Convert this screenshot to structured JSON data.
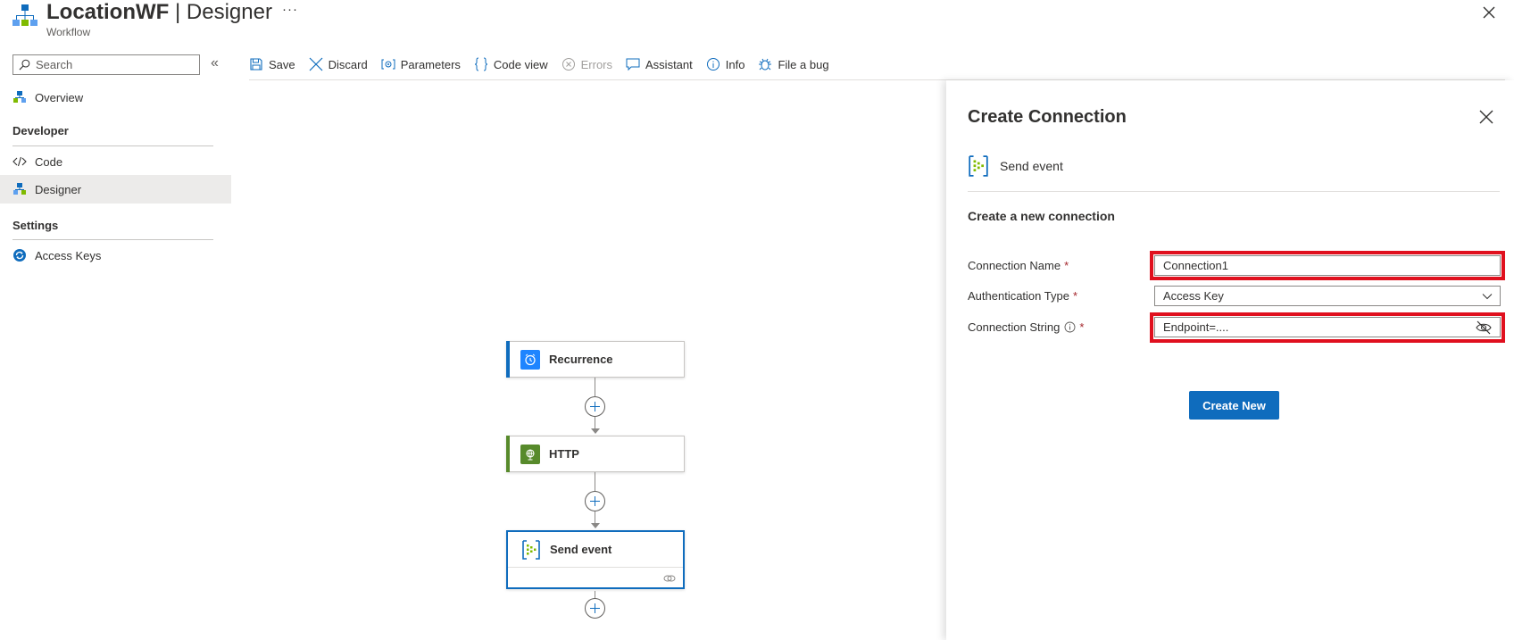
{
  "header": {
    "app_name": "LocationWF",
    "separator": " | ",
    "view_name": "Designer",
    "subtitle": "Workflow",
    "more_label": "···"
  },
  "sidebar": {
    "search_placeholder": "Search",
    "collapse_glyph": "«",
    "items": [
      {
        "label": "Overview",
        "icon": "overview-icon"
      },
      {
        "label": "Code",
        "icon": "code-icon"
      },
      {
        "label": "Designer",
        "icon": "designer-icon"
      },
      {
        "label": "Access Keys",
        "icon": "access-keys-icon"
      }
    ],
    "sections": {
      "developer": "Developer",
      "settings": "Settings"
    },
    "active_item": "Designer"
  },
  "toolbar": {
    "save": "Save",
    "discard": "Discard",
    "parameters": "Parameters",
    "code_view": "Code view",
    "errors": "Errors",
    "assistant": "Assistant",
    "info": "Info",
    "file_bug": "File a bug"
  },
  "canvas": {
    "nodes": [
      {
        "label": "Recurrence",
        "color": "#0f6cbd",
        "icon": "clock-icon"
      },
      {
        "label": "HTTP",
        "color": "#578a2b",
        "icon": "globe-icon"
      },
      {
        "label": "Send event",
        "color": "#0f6cbd",
        "icon": "event-hub-icon",
        "selected": true
      }
    ]
  },
  "panel": {
    "title": "Create Connection",
    "operation": "Send event",
    "subtitle": "Create a new connection",
    "fields": {
      "connection_name": {
        "label": "Connection Name",
        "required_mark": "*",
        "value": "Connection1"
      },
      "auth_type": {
        "label": "Authentication Type",
        "required_mark": "*",
        "value": "Access Key"
      },
      "connection_string": {
        "label": "Connection String",
        "required_mark": "*",
        "value": "Endpoint=...."
      }
    },
    "create_button": "Create New"
  },
  "colors": {
    "accent": "#0f6cbd",
    "highlight": "#e0101e",
    "required": "#a4262c"
  }
}
